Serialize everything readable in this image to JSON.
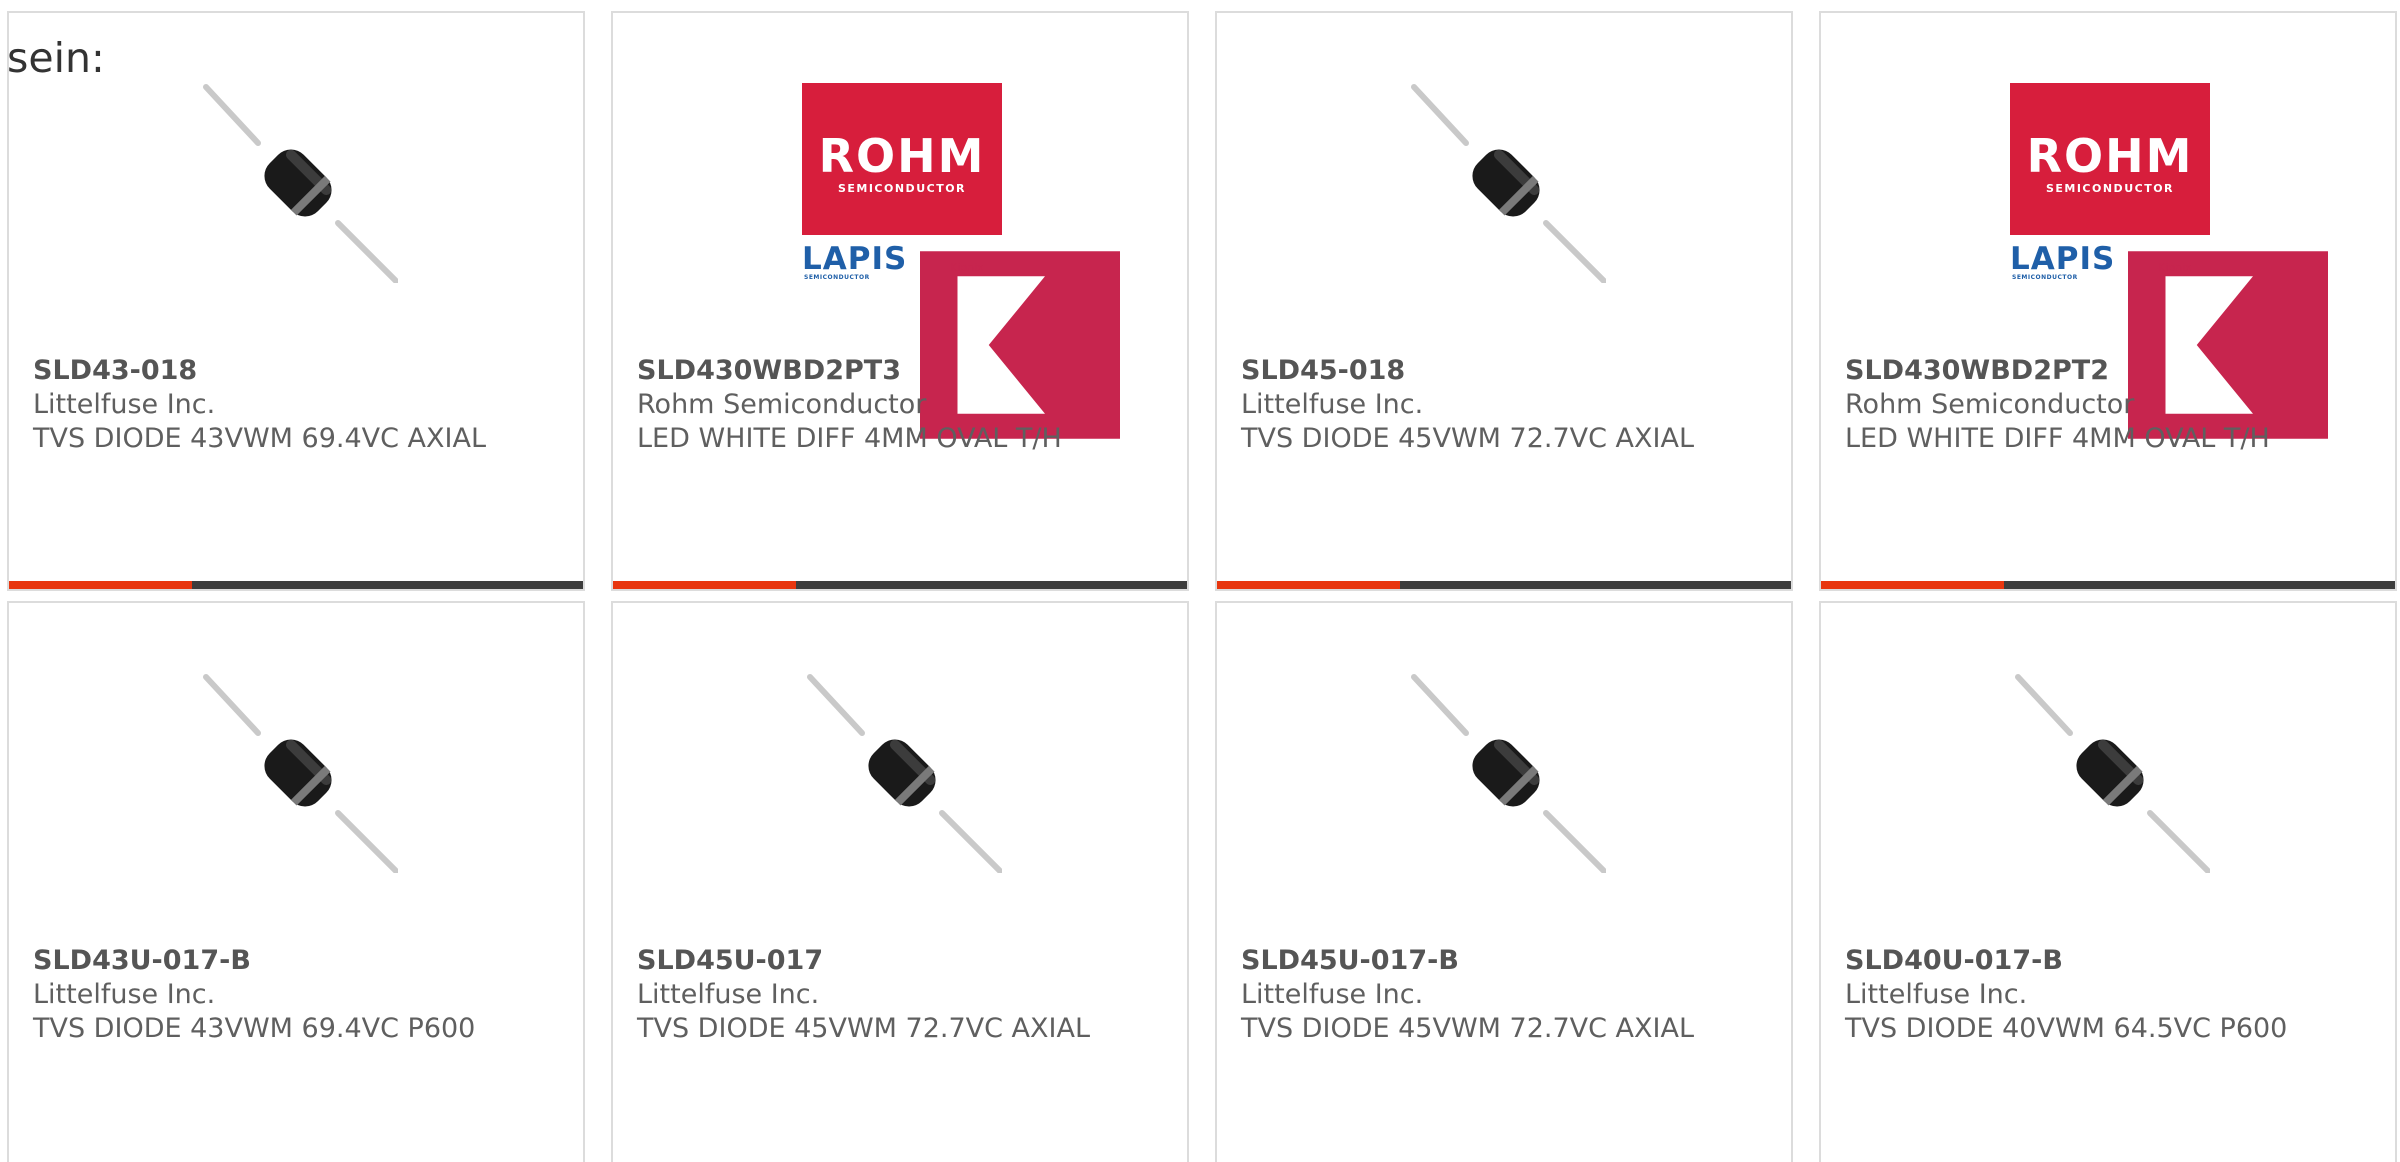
{
  "lead_text": "sein:",
  "colors": {
    "accent": "#e8360f",
    "bar": "#3d3d3d",
    "card_border": "#dcdcdc",
    "rohm_red": "#d71e3c",
    "lapis_blue": "#1f5fa8",
    "kionix_pink": "#c7254e"
  },
  "rohm_logo": {
    "word": "ROHM",
    "sub": "SEMICONDUCTOR",
    "lapis": "LAPIS",
    "lapis_sub": "SEMICONDUCTOR",
    "kionix": "Kionix"
  },
  "products": [
    {
      "part_number": "SLD43-018",
      "manufacturer": "Littelfuse Inc.",
      "description": "TVS DIODE 43VWM 69.4VC AXIAL",
      "image": "axial-diode-icon"
    },
    {
      "part_number": "SLD430WBD2PT3",
      "manufacturer": "Rohm Semiconductor",
      "description": "LED WHITE DIFF 4MM OVAL T/H",
      "image": "rohm-logo"
    },
    {
      "part_number": "SLD45-018",
      "manufacturer": "Littelfuse Inc.",
      "description": "TVS DIODE 45VWM 72.7VC AXIAL",
      "image": "axial-diode-icon"
    },
    {
      "part_number": "SLD430WBD2PT2",
      "manufacturer": "Rohm Semiconductor",
      "description": "LED WHITE DIFF 4MM OVAL T/H",
      "image": "rohm-logo"
    },
    {
      "part_number": "SLD43U-017-B",
      "manufacturer": "Littelfuse Inc.",
      "description": "TVS DIODE 43VWM 69.4VC P600",
      "image": "axial-diode-icon"
    },
    {
      "part_number": "SLD45U-017",
      "manufacturer": "Littelfuse Inc.",
      "description": "TVS DIODE 45VWM 72.7VC AXIAL",
      "image": "axial-diode-icon"
    },
    {
      "part_number": "SLD45U-017-B",
      "manufacturer": "Littelfuse Inc.",
      "description": "TVS DIODE 45VWM 72.7VC AXIAL",
      "image": "axial-diode-icon"
    },
    {
      "part_number": "SLD40U-017-B",
      "manufacturer": "Littelfuse Inc.",
      "description": "TVS DIODE 40VWM 64.5VC P600",
      "image": "axial-diode-icon"
    }
  ]
}
